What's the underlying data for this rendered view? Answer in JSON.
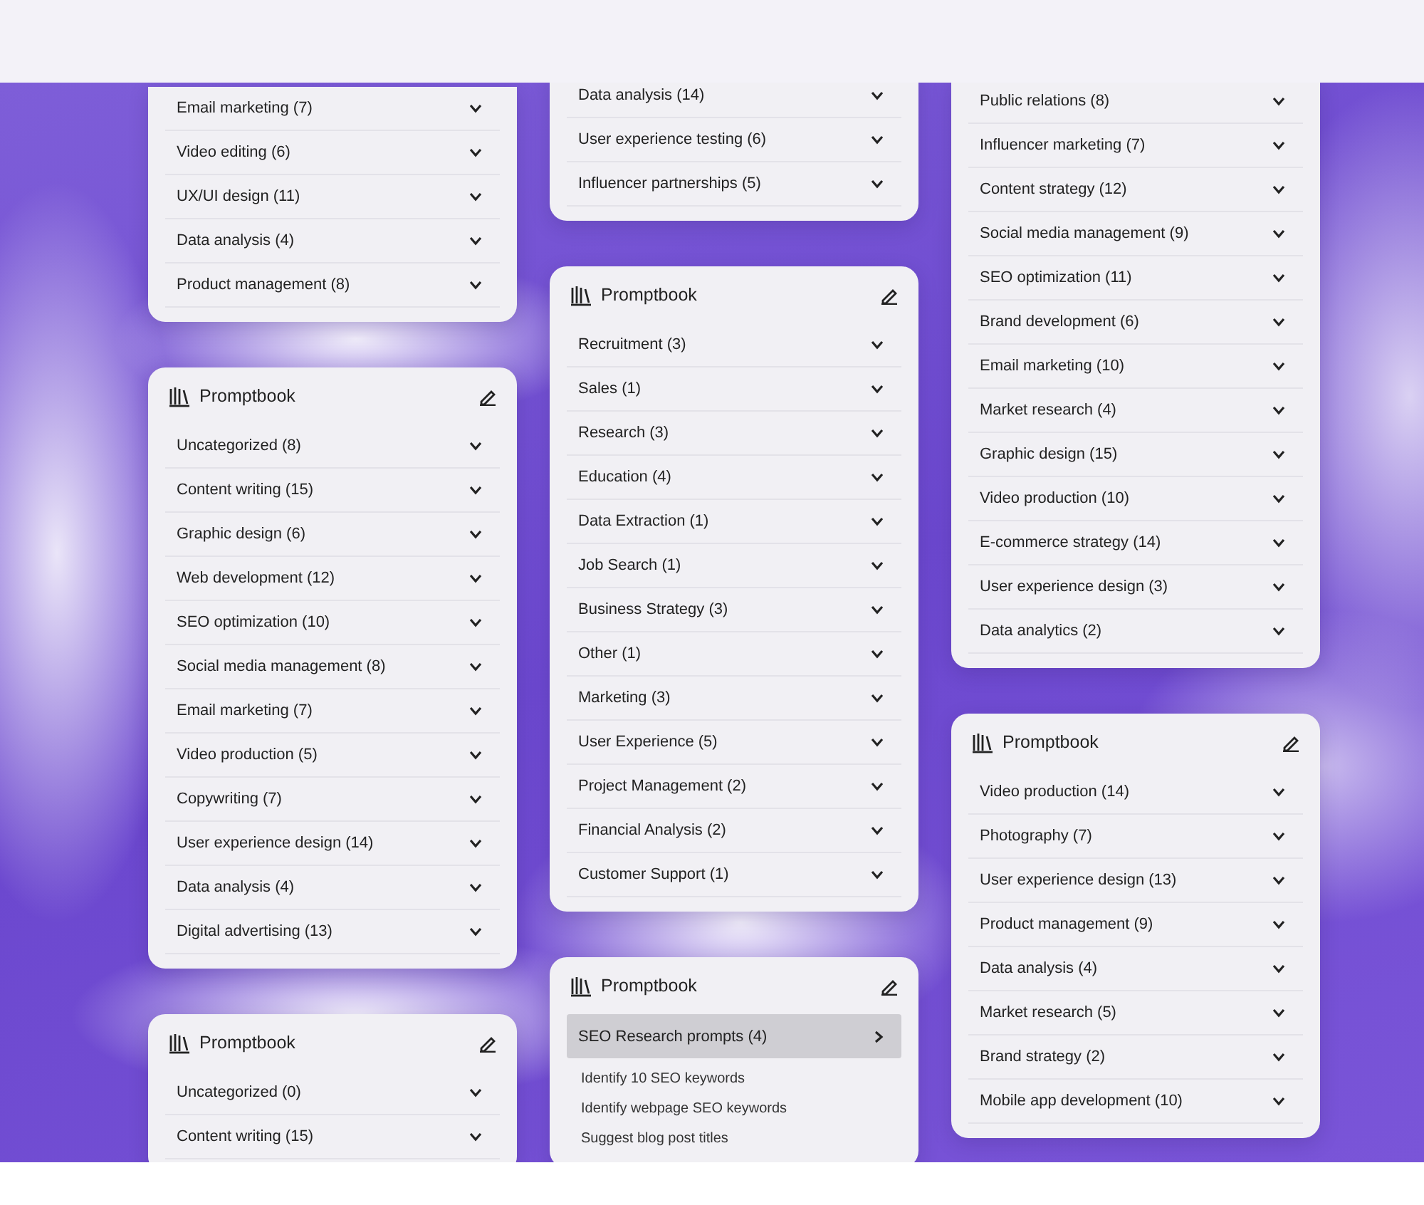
{
  "columns": [
    {
      "cards": [
        {
          "folders": [
            {
              "label": "Email marketing (7)",
              "expanded": false
            },
            {
              "label": "Video editing (6)",
              "expanded": false
            },
            {
              "label": "UX/UI design (11)",
              "expanded": false
            },
            {
              "label": "Data analysis (4)",
              "expanded": false
            },
            {
              "label": "Product management (8)",
              "expanded": false
            }
          ]
        },
        {
          "title": "Promptbook",
          "folders": [
            {
              "label": "Uncategorized (8)",
              "expanded": false
            },
            {
              "label": "Content writing (15)",
              "expanded": false
            },
            {
              "label": "Graphic design (6)",
              "expanded": false
            },
            {
              "label": "Web development (12)",
              "expanded": false
            },
            {
              "label": "SEO optimization (10)",
              "expanded": false
            },
            {
              "label": "Social media management (8)",
              "expanded": false
            },
            {
              "label": "Email marketing (7)",
              "expanded": false
            },
            {
              "label": "Video production (5)",
              "expanded": false
            },
            {
              "label": "Copywriting (7)",
              "expanded": false
            },
            {
              "label": "User experience design (14)",
              "expanded": false
            },
            {
              "label": "Data analysis (4)",
              "expanded": false
            },
            {
              "label": "Digital advertising (13)",
              "expanded": false
            }
          ]
        },
        {
          "title": "Promptbook",
          "folders": [
            {
              "label": "Uncategorized (0)",
              "expanded": false
            },
            {
              "label": "Content writing (15)",
              "expanded": false
            }
          ]
        }
      ]
    },
    {
      "cards": [
        {
          "folders": [
            {
              "label": "Data analysis (14)",
              "expanded": false
            },
            {
              "label": "User experience testing (6)",
              "expanded": false
            },
            {
              "label": "Influencer partnerships (5)",
              "expanded": false
            }
          ]
        },
        {
          "title": "Promptbook",
          "folders": [
            {
              "label": "Recruitment (3)",
              "expanded": false
            },
            {
              "label": "Sales (1)",
              "expanded": false
            },
            {
              "label": "Research (3)",
              "expanded": false
            },
            {
              "label": "Education (4)",
              "expanded": false
            },
            {
              "label": "Data Extraction (1)",
              "expanded": false
            },
            {
              "label": "Job Search (1)",
              "expanded": false
            },
            {
              "label": "Business Strategy (3)",
              "expanded": false
            },
            {
              "label": "Other (1)",
              "expanded": false
            },
            {
              "label": "Marketing (3)",
              "expanded": false
            },
            {
              "label": "User Experience (5)",
              "expanded": false
            },
            {
              "label": "Project Management (2)",
              "expanded": false
            },
            {
              "label": "Financial Analysis (2)",
              "expanded": false
            },
            {
              "label": "Customer Support (1)",
              "expanded": false
            }
          ]
        },
        {
          "title": "Promptbook",
          "folders": [
            {
              "label": "SEO Research prompts (4)",
              "expanded": true,
              "prompts": [
                "Identify 10 SEO keywords",
                "Identify webpage SEO keywords",
                "Suggest blog post titles"
              ]
            }
          ]
        }
      ]
    },
    {
      "cards": [
        {
          "folders": [
            {
              "label": "Public relations (8)",
              "expanded": false
            },
            {
              "label": "Influencer marketing (7)",
              "expanded": false
            },
            {
              "label": "Content strategy (12)",
              "expanded": false
            },
            {
              "label": "Social media management (9)",
              "expanded": false
            },
            {
              "label": "SEO optimization (11)",
              "expanded": false
            },
            {
              "label": "Brand development (6)",
              "expanded": false
            },
            {
              "label": "Email marketing (10)",
              "expanded": false
            },
            {
              "label": "Market research (4)",
              "expanded": false
            },
            {
              "label": "Graphic design (15)",
              "expanded": false
            },
            {
              "label": "Video production (10)",
              "expanded": false
            },
            {
              "label": "E-commerce strategy (14)",
              "expanded": false
            },
            {
              "label": "User experience design (3)",
              "expanded": false
            },
            {
              "label": "Data analytics (2)",
              "expanded": false
            }
          ]
        },
        {
          "title": "Promptbook",
          "folders": [
            {
              "label": "Video production (14)",
              "expanded": false
            },
            {
              "label": "Photography (7)",
              "expanded": false
            },
            {
              "label": "User experience design (13)",
              "expanded": false
            },
            {
              "label": "Product management (9)",
              "expanded": false
            },
            {
              "label": "Data analysis (4)",
              "expanded": false
            },
            {
              "label": "Market research (5)",
              "expanded": false
            },
            {
              "label": "Brand strategy (2)",
              "expanded": false
            },
            {
              "label": "Mobile app development (10)",
              "expanded": false
            }
          ]
        }
      ]
    }
  ]
}
